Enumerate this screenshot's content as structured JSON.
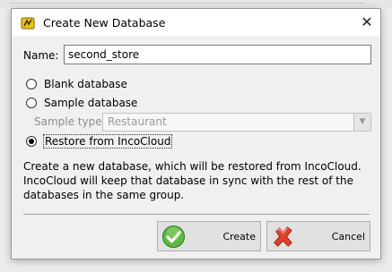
{
  "window": {
    "title": "Create New Database",
    "close_label": "✕"
  },
  "name_field": {
    "label": "Name:",
    "value": "second_store"
  },
  "options": {
    "blank": {
      "label": "Blank database",
      "checked": false
    },
    "sample": {
      "label": "Sample database",
      "checked": false
    },
    "restore": {
      "label": "Restore from IncoCloud",
      "checked": true
    }
  },
  "sample_type": {
    "label": "Sample type:",
    "value": "Restaurant",
    "disabled": true
  },
  "description": "Create a new database, which will be restored from IncoCloud. IncoCloud will keep that database in sync with the rest of the databases in the same group.",
  "buttons": {
    "create": {
      "label": "Create",
      "icon": "check-icon",
      "color": "#3fa434"
    },
    "cancel": {
      "label": "Cancel",
      "icon": "cross-icon",
      "color": "#e3402a"
    }
  }
}
